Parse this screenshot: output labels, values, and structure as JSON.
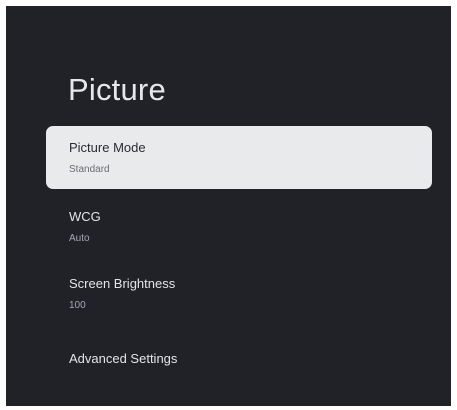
{
  "page": {
    "title": "Picture"
  },
  "menu": {
    "items": [
      {
        "label": "Picture Mode",
        "value": "Standard",
        "focused": true
      },
      {
        "label": "WCG",
        "value": "Auto",
        "focused": false
      },
      {
        "label": "Screen Brightness",
        "value": "100",
        "focused": false
      },
      {
        "label": "Advanced Settings",
        "value": null,
        "focused": false
      }
    ]
  },
  "colors": {
    "background": "#212227",
    "focus_highlight": "#e9eaec",
    "primary_text": "#e3e4e8",
    "secondary_text": "#a6a8b0"
  }
}
